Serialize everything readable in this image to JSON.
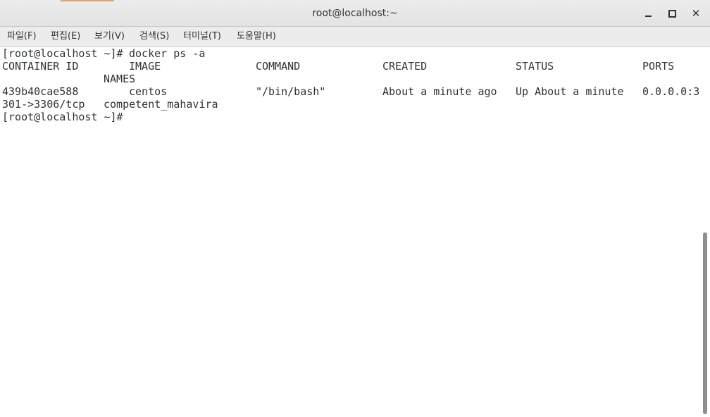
{
  "window": {
    "title": "root@localhost:~"
  },
  "menu": {
    "file": "파일(F)",
    "edit": "편집(E)",
    "view": "보기(V)",
    "search": "검색(S)",
    "terminal": "터미널(T)",
    "help": "도움말(H)"
  },
  "terminal": {
    "prompt1": "[root@localhost ~]#",
    "command": "docker ps -a",
    "headers": {
      "container_id": "CONTAINER ID",
      "image": "IMAGE",
      "command": "COMMAND",
      "created": "CREATED",
      "status": "STATUS",
      "ports": "PORTS",
      "names": "NAMES"
    },
    "row": {
      "container_id": "439b40cae588",
      "image": "centos",
      "command": "\"/bin/bash\"",
      "created": "About a minute ago",
      "status": "Up About a minute",
      "ports_part1": "0.0.0.0:3",
      "ports_part2": "301->3306/tcp",
      "names": "competent_mahavira"
    },
    "prompt2": "[root@localhost ~]#"
  },
  "colors": {
    "text": "#2e3436",
    "background": "#ffffff",
    "titlebar": "#e8e8e8"
  },
  "icons": {
    "minimize": "minimize-icon",
    "maximize": "maximize-icon",
    "close": "close-icon"
  },
  "scroll": {
    "thumb_fraction": 0.49,
    "position": "bottom"
  }
}
